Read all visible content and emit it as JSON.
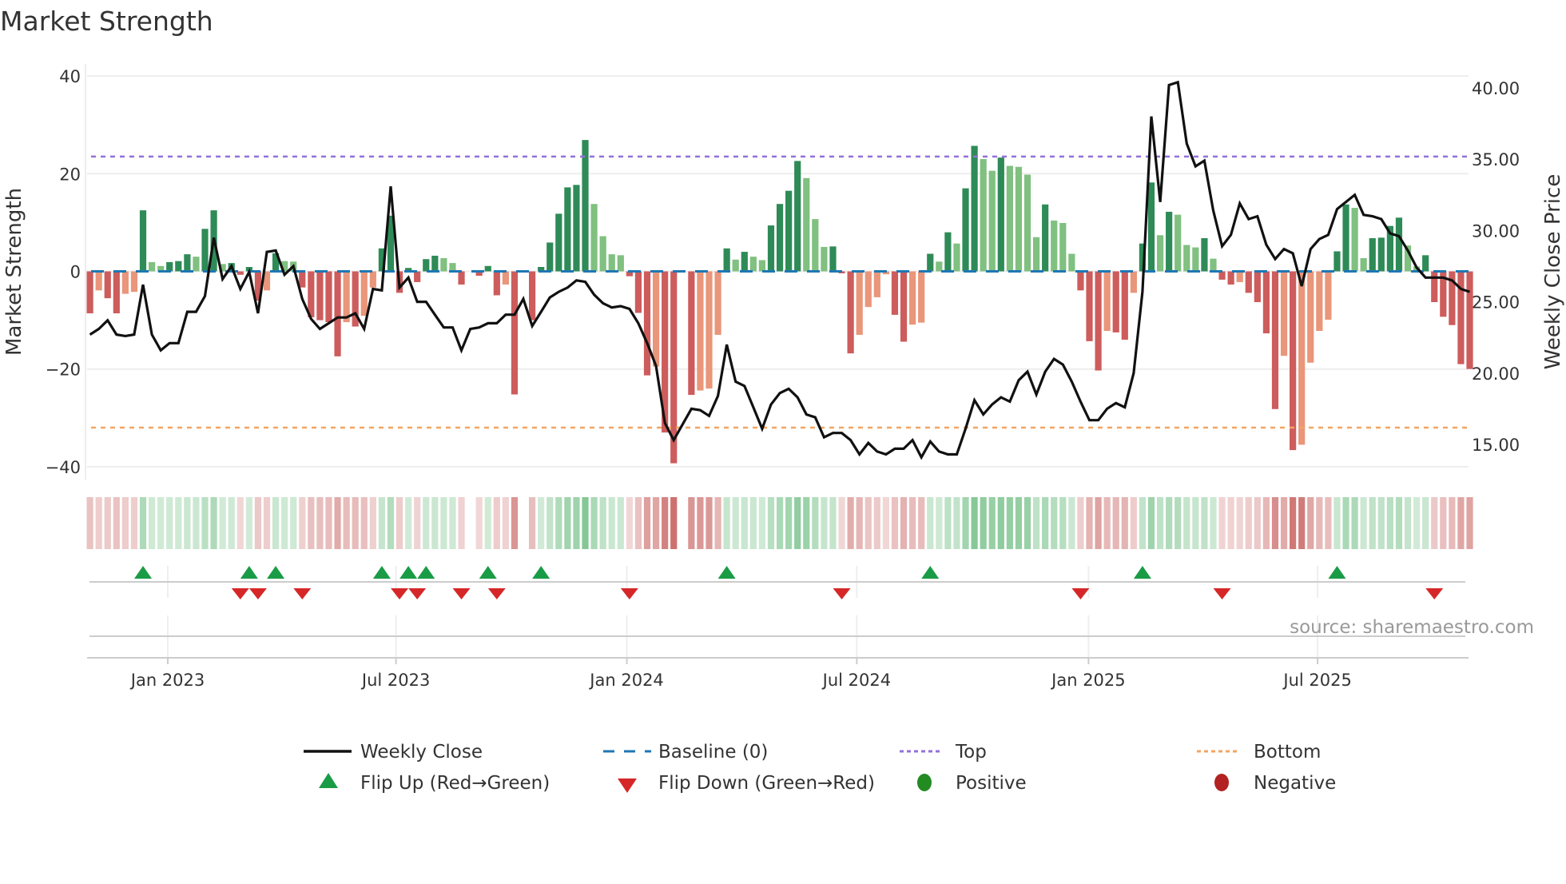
{
  "chart_data": {
    "type": "bar",
    "title": "Market Strength",
    "ylabel": "Market Strength",
    "y2label": "Weekly Close Price",
    "ylim": [
      -42,
      42
    ],
    "y2lim": [
      13.4,
      41.2
    ],
    "yticks": [
      "40",
      "20",
      "0",
      "−20",
      "−40"
    ],
    "ytick_values": [
      40,
      20,
      0,
      -20,
      -40
    ],
    "y2ticks": [
      "40.00",
      "35.00",
      "30.00",
      "25.00",
      "20.00",
      "15.00"
    ],
    "y2tick_values": [
      40,
      35,
      30,
      25,
      20,
      15
    ],
    "xticks": [
      {
        "label": "Jan 2023",
        "week": 8.8
      },
      {
        "label": "Jul 2023",
        "week": 34.6
      },
      {
        "label": "Jan 2024",
        "week": 60.7
      },
      {
        "label": "Jul 2024",
        "week": 86.7
      },
      {
        "label": "Jan 2025",
        "week": 112.9
      },
      {
        "label": "Jul 2025",
        "week": 138.8
      }
    ],
    "top_level": 23.5,
    "bottom_level": -32,
    "baseline": 0,
    "grid": true,
    "legend_placement": "bottom",
    "colors": {
      "pos_strong": "#2e8b57",
      "pos_weak": "#80c080",
      "neg_strong": "#cd5c5c",
      "neg_weak": "#e9967a",
      "price": "#111111",
      "baseline": "#1f77b4",
      "top": "#9370db",
      "bottom": "#f4a460",
      "flip_up": "#1a9c47",
      "flip_down": "#d62728",
      "positive": "#228b22",
      "negative": "#b22222"
    },
    "strength": [
      -8.6,
      -3.9,
      -5.5,
      -8.6,
      -4.6,
      -4.2,
      12.5,
      1.9,
      1.1,
      1.9,
      2.1,
      3.5,
      3,
      8.7,
      12.5,
      1.5,
      1.7,
      -0.7,
      0.9,
      -6,
      -3.9,
      3.7,
      2.1,
      2,
      -3.3,
      -9.4,
      -10,
      -10.4,
      -17.4,
      -10.4,
      -11.3,
      -9.1,
      -3.3,
      4.7,
      11.4,
      -4.4,
      0.7,
      -2.2,
      2.5,
      3.2,
      2.7,
      1.7,
      -2.7,
      0,
      -0.9,
      1.1,
      -4.9,
      -2.7,
      -25.2,
      0,
      -10,
      0.9,
      5.9,
      11.8,
      17.2,
      17.7,
      26.9,
      13.8,
      7.2,
      3.5,
      3.3,
      -1,
      -8.5,
      -21.3,
      -19.5,
      -33,
      -39.3,
      0,
      -25.3,
      -24.4,
      -24,
      -13,
      4.7,
      2.4,
      4,
      3,
      2.3,
      9.4,
      13.8,
      16.5,
      22.6,
      19.1,
      10.7,
      5,
      5.1,
      -0.4,
      -16.8,
      -13,
      -7.3,
      -5.3,
      -0.6,
      -8.9,
      -14.4,
      -10.9,
      -10.5,
      3.6,
      2,
      8,
      5.7,
      17,
      25.7,
      23,
      20.6,
      23.3,
      21.6,
      21.4,
      19.8,
      7,
      13.7,
      10.4,
      9.9,
      3.6,
      -3.9,
      -14.3,
      -20.3,
      -12.2,
      -12.5,
      -14,
      -4.4,
      5.7,
      18.2,
      7.4,
      12.2,
      11.6,
      5.4,
      4.9,
      6.8,
      2.6,
      -1.7,
      -2.7,
      -2.2,
      -4.4,
      -6.3,
      -12.7,
      -28.2,
      -17.3,
      -36.6,
      -35.5,
      -18.7,
      -12.2,
      -9.9,
      4.1,
      13.7,
      13,
      2.7,
      6.8,
      6.9,
      9.3,
      11,
      5.3,
      1,
      3.3,
      -6.3,
      -9.3,
      -11,
      -19,
      -20
    ],
    "weekly_close": [
      22.7,
      23.1,
      23.7,
      22.7,
      22.6,
      22.7,
      26.2,
      22.7,
      21.6,
      22.1,
      22.1,
      24.3,
      24.3,
      25.4,
      29.5,
      26.6,
      27.5,
      25.9,
      27.1,
      24.2,
      28.5,
      28.6,
      26.9,
      27.5,
      25.2,
      23.8,
      23.1,
      23.5,
      23.9,
      23.9,
      24.2,
      23.1,
      25.9,
      25.8,
      33.1,
      26.0,
      26.7,
      25.0,
      25.0,
      24.1,
      23.2,
      23.2,
      21.6,
      23.1,
      23.2,
      23.5,
      23.5,
      24.1,
      24.1,
      25.2,
      23.3,
      24.3,
      25.3,
      25.7,
      26.0,
      26.5,
      26.4,
      25.5,
      24.9,
      24.6,
      24.7,
      24.5,
      23.5,
      22.1,
      20.5,
      16.5,
      15.3,
      16.4,
      17.5,
      17.4,
      17.0,
      18.4,
      22.0,
      19.4,
      19.1,
      17.6,
      16.1,
      17.8,
      18.6,
      18.9,
      18.3,
      17.1,
      16.9,
      15.5,
      15.8,
      15.8,
      15.3,
      14.3,
      15.1,
      14.5,
      14.3,
      14.7,
      14.7,
      15.3,
      14.1,
      15.2,
      14.5,
      14.3,
      14.3,
      16.1,
      18.1,
      17.1,
      17.8,
      18.3,
      18.0,
      19.5,
      20.1,
      18.5,
      20.1,
      21.0,
      20.6,
      19.4,
      18.0,
      16.7,
      16.7,
      17.5,
      17.9,
      17.6,
      20.0,
      25.7,
      38.0,
      32.0,
      40.2,
      40.4,
      36.1,
      34.5,
      34.9,
      31.4,
      28.9,
      29.7,
      31.9,
      30.8,
      31.0,
      29.0,
      28.0,
      28.7,
      28.4,
      26.1,
      28.7,
      29.4,
      29.7,
      31.5,
      32.0,
      32.5,
      31.1,
      31.0,
      30.8,
      29.8,
      29.6,
      28.6,
      27.4,
      26.7,
      26.7,
      26.7,
      26.5,
      25.9,
      25.7
    ]
  },
  "source": "source: sharemaestro.com",
  "legend": {
    "weekly_close": "Weekly Close",
    "baseline": "Baseline (0)",
    "top": "Top",
    "bottom": "Bottom",
    "flip_up": "Flip Up (Red→Green)",
    "flip_down": "Flip Down (Green→Red)",
    "positive": "Positive",
    "negative": "Negative"
  }
}
